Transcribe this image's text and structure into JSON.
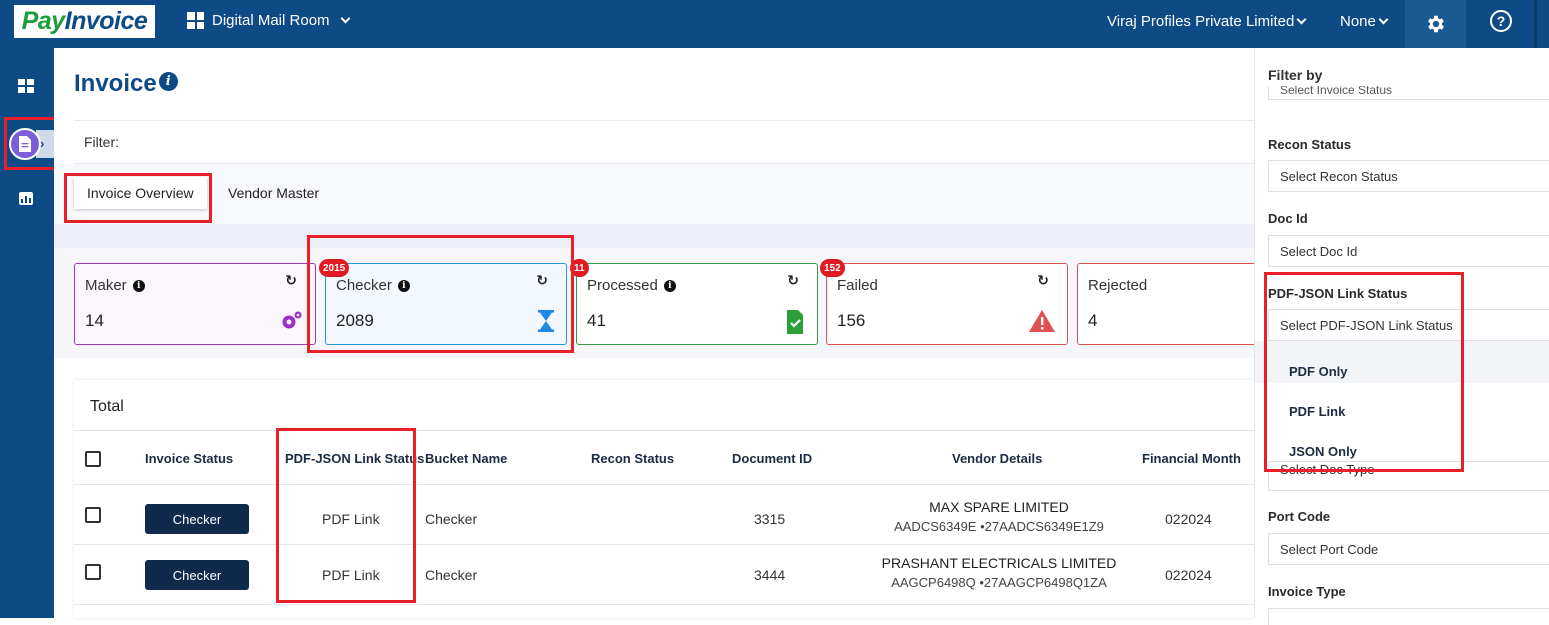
{
  "header": {
    "logo": {
      "part1": "Pay",
      "part2": "Invoice"
    },
    "app_name": "Digital Mail Room",
    "company": "Viraj Profiles Private Limited",
    "scope": "None"
  },
  "sidebar": {
    "items": [
      {
        "name": "dashboard",
        "icon": "dashboard-icon"
      },
      {
        "name": "invoice",
        "icon": "document-icon",
        "active": true
      },
      {
        "name": "reports",
        "icon": "bar-chart-icon"
      }
    ]
  },
  "page": {
    "title": "Invoice",
    "filter_label": "Filter:",
    "tabs": [
      {
        "label": "Invoice Overview",
        "active": true
      },
      {
        "label": "Vendor Master",
        "active": false
      }
    ]
  },
  "cards": [
    {
      "label": "Maker",
      "value": "14",
      "badge": "",
      "border": "#a23ab8",
      "bg": "#fbf6fc",
      "icon": "gear-icon"
    },
    {
      "label": "Checker",
      "value": "2089",
      "badge": "2015",
      "border": "#1e9bd7",
      "bg": "#f3f8fe",
      "icon": "hourglass-icon"
    },
    {
      "label": "Processed",
      "value": "41",
      "badge": "11",
      "border": "#2f9e44",
      "bg": "#ffffff",
      "icon": "file-check-icon"
    },
    {
      "label": "Failed",
      "value": "156",
      "badge": "152",
      "border": "#e05252",
      "bg": "#ffffff",
      "icon": "warning-icon"
    },
    {
      "label": "Rejected",
      "value": "4",
      "badge": "",
      "border": "#e05252",
      "bg": "#ffffff",
      "icon": ""
    }
  ],
  "table": {
    "title": "Total",
    "columns": [
      "Invoice Status",
      "PDF-JSON Link Status",
      "Bucket Name",
      "Recon Status",
      "Document ID",
      "Vendor Details",
      "Financial Month"
    ],
    "rows": [
      {
        "status": "Checker",
        "link_status": "PDF Link",
        "bucket": "Checker",
        "recon": "",
        "doc_id": "3315",
        "vendor_name": "MAX SPARE LIMITED",
        "vendor_pan": "AADCS6349E",
        "vendor_gstin": "•27AADCS6349E1Z9",
        "fin_month": "022024"
      },
      {
        "status": "Checker",
        "link_status": "PDF Link",
        "bucket": "Checker",
        "recon": "",
        "doc_id": "3444",
        "vendor_name": "PRASHANT ELECTRICALS LIMITED",
        "vendor_pan": "AAGCP6498Q",
        "vendor_gstin": "•27AAGCP6498Q1ZA",
        "fin_month": "022024"
      }
    ]
  },
  "filter_panel": {
    "title": "Filter by",
    "invoice_status_placeholder": "Select Invoice Status",
    "recon_status_label": "Recon Status",
    "recon_status_placeholder": "Select Recon Status",
    "doc_id_label": "Doc Id",
    "doc_id_placeholder": "Select Doc Id",
    "link_status_label": "PDF-JSON Link Status",
    "link_status_placeholder": "Select PDF-JSON Link Status",
    "link_status_options": [
      "PDF Only",
      "PDF Link",
      "JSON Only"
    ],
    "doc_type_placeholder": "Select Doc Type",
    "port_code_label": "Port Code",
    "port_code_placeholder": "Select Port Code",
    "invoice_type_label": "Invoice Type"
  },
  "colors": {
    "brand": "#0d4a86",
    "highlight": "#e8202a",
    "status_button": "#0f2a4a"
  }
}
